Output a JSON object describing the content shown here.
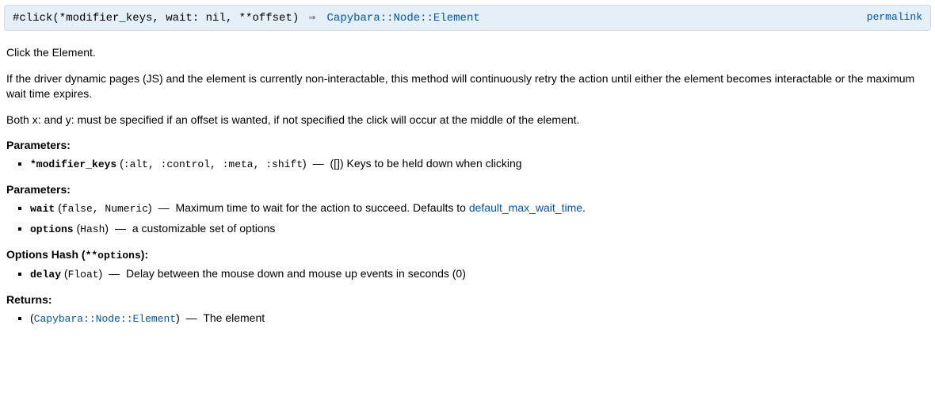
{
  "header": {
    "signature_prefix": "#click(*modifier_keys, wait: nil, **offset) ",
    "arrow": "⇒",
    "return_type": " Capybara::Node::Element ",
    "permalink": "permalink"
  },
  "desc": {
    "p1": "Click the Element.",
    "p2": "If the driver dynamic pages (JS) and the element is currently non-interactable, this method will continuously retry the action until either the element becomes interactable or the maximum wait time expires.",
    "p3": "Both x: and y: must be specified if an offset is wanted, if not specified the click will occur at the middle of the element."
  },
  "sections": {
    "parameters_label": "Parameters:",
    "options_hash_prefix": "Options Hash (",
    "options_hash_code": "**options",
    "options_hash_suffix": "):",
    "returns_label": "Returns:"
  },
  "params1": {
    "name": "*modifier_keys",
    "types": ":alt, :control, :meta, :shift",
    "default": "[]",
    "desc": "Keys to be held down when clicking"
  },
  "params2a": {
    "name": "wait",
    "types": "false, Numeric",
    "desc_prefix": "Maximum time to wait for the action to succeed. Defaults to ",
    "link": "default_max_wait_time",
    "desc_suffix": "."
  },
  "params2b": {
    "name": "options",
    "types": "Hash",
    "desc": "a customizable set of options"
  },
  "opts": {
    "name": "delay",
    "types": "Float",
    "desc": "Delay between the mouse down and mouse up events in seconds (0)"
  },
  "returns": {
    "type": "Capybara::Node::Element",
    "desc": "The element"
  }
}
